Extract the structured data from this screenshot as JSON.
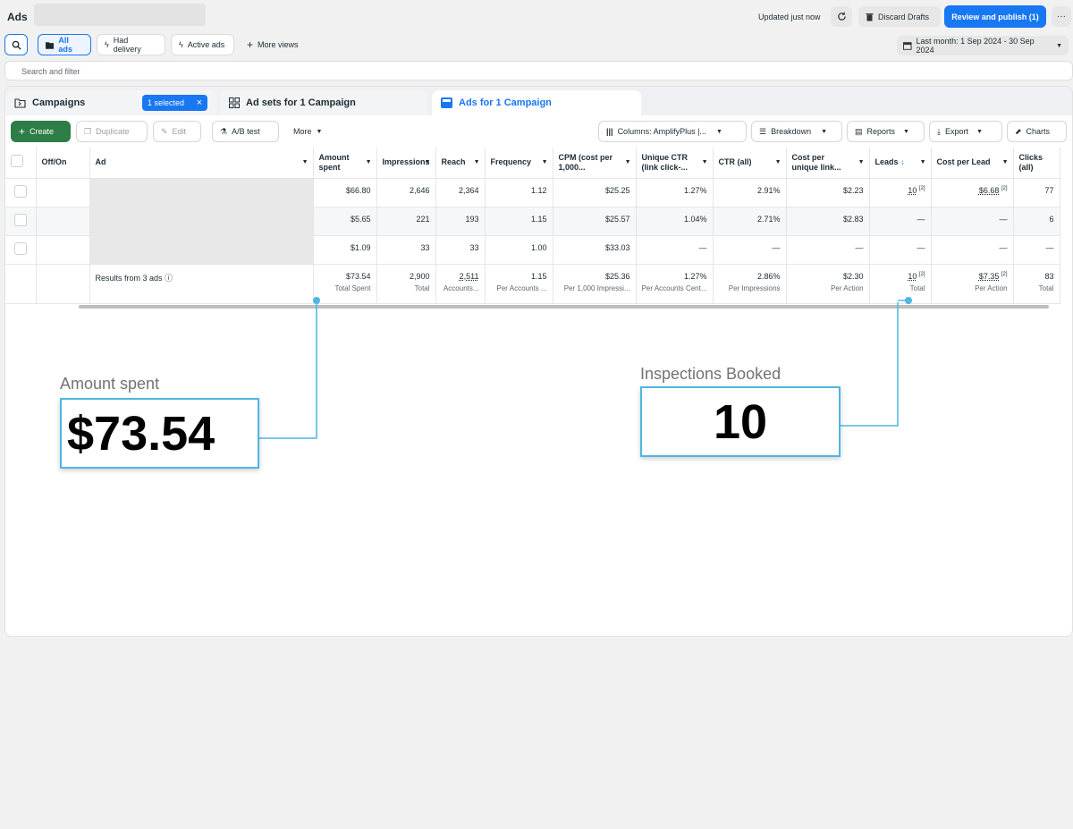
{
  "topbar": {
    "title": "Ads",
    "updated": "Updated just now",
    "discard": "Discard Drafts",
    "publish": "Review and publish (1)",
    "more": "···"
  },
  "views": {
    "all_ads": "All ads",
    "had_delivery": "Had delivery",
    "active_ads": "Active ads",
    "more_views": "More views",
    "date_range": "Last month: 1 Sep 2024 - 30 Sep 2024"
  },
  "search": {
    "placeholder": "Search and filter"
  },
  "tabs": {
    "campaigns": "Campaigns",
    "selected": "1 selected",
    "adsets": "Ad sets for 1 Campaign",
    "ads": "Ads for 1 Campaign"
  },
  "toolbar": {
    "create": "Create",
    "duplicate": "Duplicate",
    "edit": "Edit",
    "ab_test": "A/B test",
    "more": "More",
    "columns": "Columns: AmplifyPlus |...",
    "breakdown": "Breakdown",
    "reports": "Reports",
    "export": "Export",
    "charts": "Charts"
  },
  "table": {
    "headers": {
      "offon": "Off/On",
      "ad": "Ad",
      "amount": "Amount spent",
      "impressions": "Impressions",
      "reach": "Reach",
      "frequency": "Frequency",
      "cpm": "CPM (cost per 1,000...",
      "uctr": "Unique CTR (link click-...",
      "ctr": "CTR (all)",
      "cpu": "Cost per unique link...",
      "leads": "Leads",
      "cpl": "Cost per Lead",
      "clicks": "Clicks (all)"
    },
    "rows": [
      {
        "amount": "$66.80",
        "impressions": "2,646",
        "reach": "2,364",
        "frequency": "1.12",
        "cpm": "$25.25",
        "uctr": "1.27%",
        "ctr": "2.91%",
        "cpu": "$2.23",
        "leads": "10",
        "leads_note": "[2]",
        "cpl": "$6.68",
        "cpl_note": "[2]",
        "clicks": "77"
      },
      {
        "amount": "$5.65",
        "impressions": "221",
        "reach": "193",
        "frequency": "1.15",
        "cpm": "$25.57",
        "uctr": "1.04%",
        "ctr": "2.71%",
        "cpu": "$2.83",
        "leads": "—",
        "leads_note": "",
        "cpl": "—",
        "cpl_note": "",
        "clicks": "6"
      },
      {
        "amount": "$1.09",
        "impressions": "33",
        "reach": "33",
        "frequency": "1.00",
        "cpm": "$33.03",
        "uctr": "—",
        "ctr": "—",
        "cpu": "—",
        "leads": "—",
        "leads_note": "",
        "cpl": "—",
        "cpl_note": "",
        "clicks": "—"
      }
    ],
    "totals": {
      "label": "Results from 3 ads",
      "amount": "$73.54",
      "amount_sub": "Total Spent",
      "impressions": "2,900",
      "impressions_sub": "Total",
      "reach": "2,511",
      "reach_sub": "Accounts...",
      "frequency": "1.15",
      "frequency_sub": "Per Accounts ...",
      "cpm": "$25.36",
      "cpm_sub": "Per 1,000 Impressi...",
      "uctr": "1.27%",
      "uctr_sub": "Per Accounts Cent...",
      "ctr": "2.86%",
      "ctr_sub": "Per Impressions",
      "cpu": "$2.30",
      "cpu_sub": "Per Action",
      "leads": "10",
      "leads_note": "[2]",
      "leads_sub": "Total",
      "cpl": "$7.35",
      "cpl_note": "[2]",
      "cpl_sub": "Per Action",
      "clicks": "83",
      "clicks_sub": "Total"
    }
  },
  "annotations": {
    "amount_label": "Amount spent",
    "amount_value": "$73.54",
    "inspections_label": "Inspections Booked",
    "inspections_value": "10"
  },
  "colors": {
    "accent": "#1877f2",
    "create": "#2d7d46",
    "callout": "#4fb6e3"
  }
}
